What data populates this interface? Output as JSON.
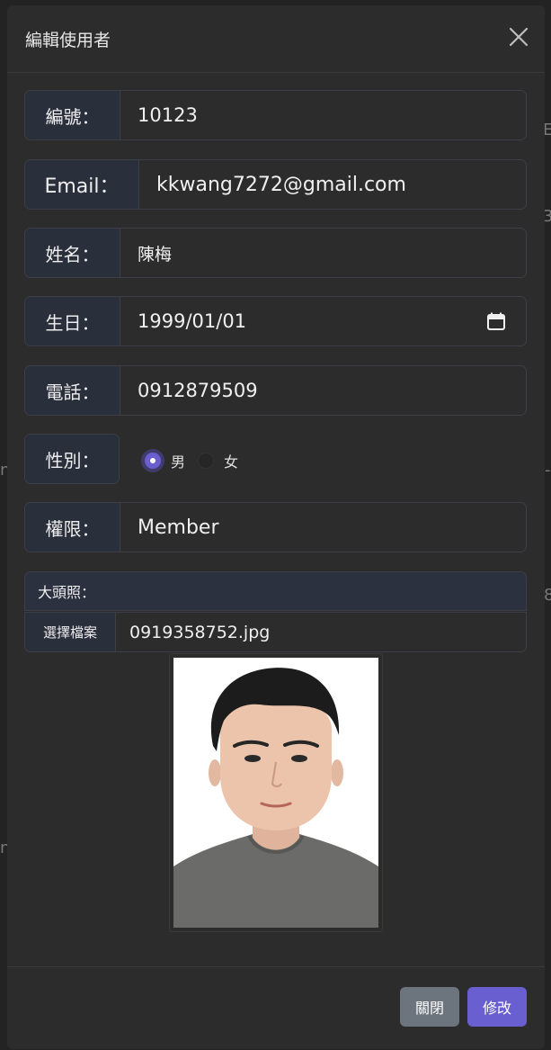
{
  "modal": {
    "title": "編輯使用者"
  },
  "form": {
    "id": {
      "label": "編號：",
      "value": "10123"
    },
    "email": {
      "label": "Email：",
      "value": "kkwang7272@gmail.com"
    },
    "name": {
      "label": "姓名：",
      "value": "陳梅"
    },
    "birthday": {
      "label": "生日：",
      "value": "1999/01/01"
    },
    "phone": {
      "label": "電話：",
      "value": "0912879509"
    },
    "gender": {
      "label": "性別：",
      "options": [
        {
          "label": "男",
          "checked": true
        },
        {
          "label": "女",
          "checked": false
        }
      ]
    },
    "role": {
      "label": "權限：",
      "value": "Member"
    },
    "avatar": {
      "label": "大頭照：",
      "choose_file_label": "選擇檔案",
      "file_name": "0919358752.jpg"
    }
  },
  "footer": {
    "close_label": "關閉",
    "save_label": "修改"
  },
  "colors": {
    "accent": "#6a5fd0",
    "secondary": "#6c757d",
    "label_bg": "#2a2f3c"
  }
}
